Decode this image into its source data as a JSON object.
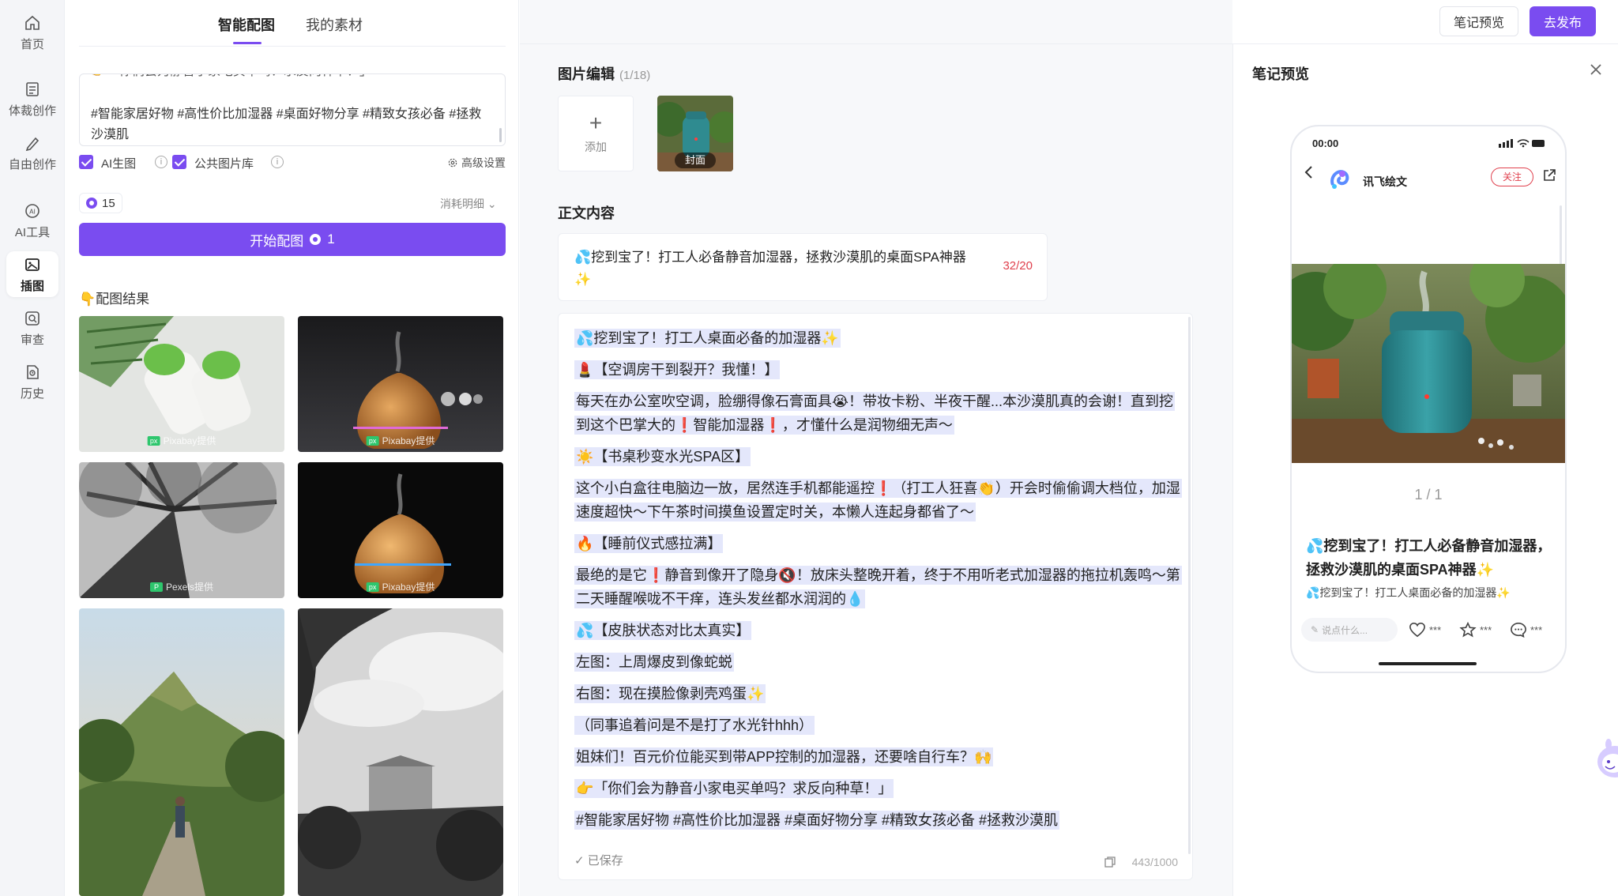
{
  "sidebar": {
    "items": [
      {
        "label": "首页",
        "icon": "home-icon"
      },
      {
        "label": "体裁创作",
        "icon": "document-icon"
      },
      {
        "label": "自由创作",
        "icon": "pen-icon"
      },
      {
        "label": "AI工具",
        "icon": "ai-icon"
      },
      {
        "label": "插图",
        "icon": "image-icon",
        "active": true
      },
      {
        "label": "审查",
        "icon": "review-icon"
      },
      {
        "label": "历史",
        "icon": "history-icon"
      }
    ]
  },
  "left_panel": {
    "tabs": [
      "智能配图",
      "我的素材"
    ],
    "active_tab": 0,
    "textarea": {
      "cut_line": "👉「你们会为静音小家电买单吗？求反向种草！」",
      "tags": "#智能家居好物 #高性价比加湿器 #桌面好物分享 #精致女孩必备 #拯救沙漠肌"
    },
    "options": {
      "ai_image": "AI生图",
      "public_library": "公共图片库",
      "advanced": "高级设置"
    },
    "credits": "15",
    "consume_detail": "消耗明细",
    "start_button": "开始配图",
    "start_cost": "1",
    "result_title": "👇配图结果",
    "results": [
      {
        "watermark": "Pixabay提供",
        "desc": "humidifier-cactus"
      },
      {
        "watermark": "Pixabay提供",
        "desc": "wood-diffuser-dark"
      },
      {
        "watermark": "Pexels提供",
        "desc": "tree-bw"
      },
      {
        "watermark": "Pixabay提供",
        "desc": "wood-diffuser-black"
      },
      {
        "watermark": "",
        "desc": "mountain-hiker"
      },
      {
        "watermark": "",
        "desc": "shed-bw"
      }
    ]
  },
  "editor": {
    "image_section_title": "图片编辑",
    "image_count": "(1/18)",
    "add_label": "添加",
    "cover_label": "封面",
    "body_section_title": "正文内容",
    "title_text": "💦挖到宝了！打工人必备静音加湿器，拯救沙漠肌的桌面SPA神器✨",
    "title_count": "32/20",
    "body_lines": [
      "💦挖到宝了！打工人桌面必备的加湿器✨",
      "💄【空调房干到裂开？我懂！】",
      "每天在办公室吹空调，脸绷得像石膏面具😭！带妆卡粉、半夜干醒...本沙漠肌真的会谢！直到挖到这个巴掌大的❗智能加湿器❗，才懂什么是润物细无声～",
      "☀️【书桌秒变水光SPA区】",
      "这个小白盒往电脑边一放，居然连手机都能遥控❗（打工人狂喜👏）开会时偷偷调大档位，加湿速度超快～下午茶时间摸鱼设置定时关，本懒人连起身都省了～",
      "🔥【睡前仪式感拉满】",
      "最绝的是它❗静音到像开了隐身🔇！放床头整晚开着，终于不用听老式加湿器的拖拉机轰鸣～第二天睡醒喉咙不干痒，连头发丝都水润润的💧",
      "💦【皮肤状态对比太真实】",
      "左图：上周爆皮到像蛇蜕",
      "右图：现在摸脸像剥壳鸡蛋✨",
      "（同事追着问是不是打了水光针hhh）",
      "姐妹们！百元价位能买到带APP控制的加湿器，还要啥自行车？🙌",
      "👉「你们会为静音小家电买单吗？求反向种草！」",
      "#智能家居好物 #高性价比加湿器 #桌面好物分享 #精致女孩必备 #拯救沙漠肌"
    ],
    "saved": "✓ 已保存",
    "char_count": "443/1000"
  },
  "topbar": {
    "preview_button": "笔记预览",
    "publish_button": "去发布"
  },
  "preview": {
    "title": "笔记预览",
    "phone": {
      "time": "00:00",
      "author": "讯飞绘文",
      "follow": "关注",
      "page": "1 / 1",
      "note_title": "💦挖到宝了！打工人必备静音加湿器，拯救沙漠肌的桌面SPA神器✨",
      "note_sub": "💦挖到宝了！打工人桌面必备的加湿器✨",
      "comment_placeholder": "说点什么...",
      "likes": "***",
      "stars": "***",
      "comments": "***"
    }
  },
  "colors": {
    "accent": "#7a4cf0",
    "highlight": "#e4e7fb",
    "warn": "#e0414e"
  }
}
